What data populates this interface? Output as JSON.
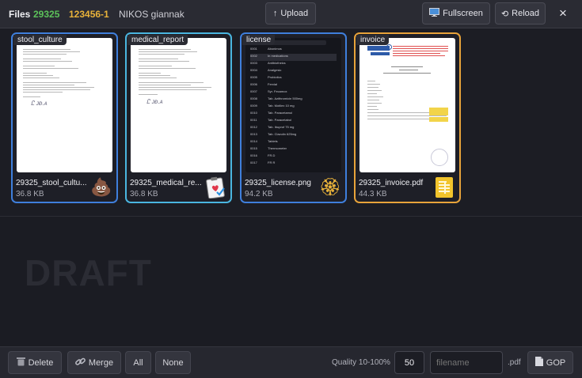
{
  "header": {
    "title": "Files",
    "patient_id": "29325",
    "patient_code": "123456-1",
    "patient_name": "NIKOS giannak",
    "upload_label": "Upload",
    "fullscreen_label": "Fullscreen",
    "reload_label": "Reload",
    "close_label": "×"
  },
  "files": [
    {
      "tag": "stool_culture",
      "filename": "29325_stool_cultu...",
      "size": "36.8 KB",
      "emoji": "💩"
    },
    {
      "tag": "medical_report",
      "filename": "29325_medical_re...",
      "size": "36.8 KB",
      "emoji": "📋"
    },
    {
      "tag": "license",
      "filename": "29325_license.png",
      "size": "94.2 KB",
      "emoji": "🏵"
    },
    {
      "tag": "invoice",
      "filename": "29325_invoice.pdf",
      "size": "44.3 KB",
      "emoji": "🧾"
    }
  ],
  "draft": {
    "label": "DRAFT"
  },
  "footer": {
    "delete_label": "Delete",
    "merge_label": "Merge",
    "all_label": "All",
    "none_label": "None",
    "quality_label": "Quality 10-100%",
    "quality_value": "50",
    "filename_placeholder": "filename",
    "extension": ".pdf",
    "gop_label": "GOP"
  },
  "colors": {
    "id_green": "#5cc15a",
    "code_amber": "#e8b23a",
    "border_blue": "#3f7fdc",
    "border_teal": "#4ab6e0",
    "border_amber": "#e8a33a"
  }
}
